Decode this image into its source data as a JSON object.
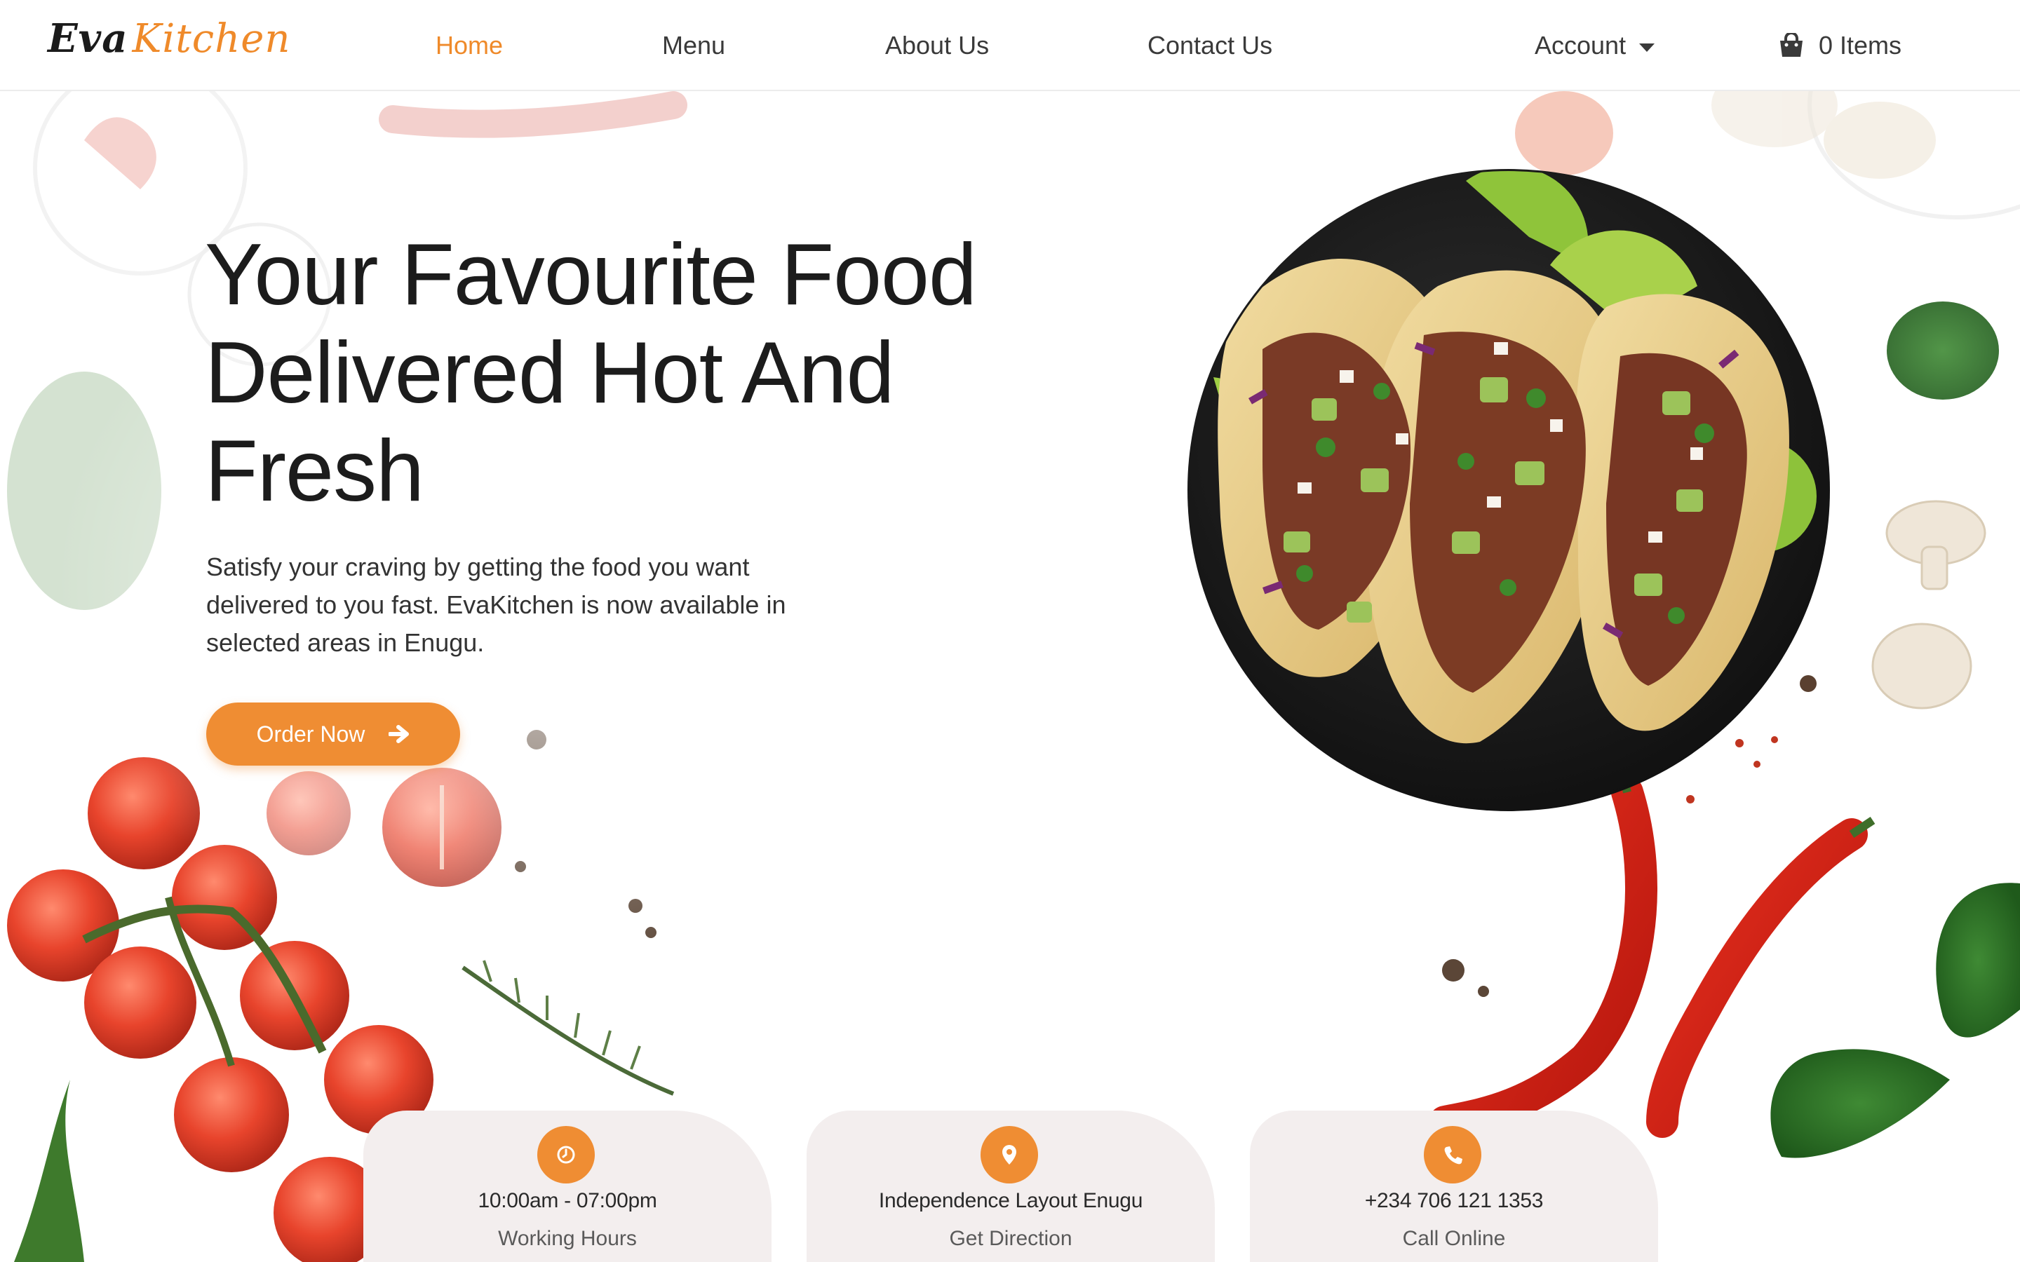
{
  "brand": {
    "part1": "Eva",
    "part2": "Kitchen",
    "accent_color": "#ef8a2a"
  },
  "nav": {
    "home": "Home",
    "menu": "Menu",
    "about": "About Us",
    "contact": "Contact Us",
    "account": "Account",
    "cart": "0 Items",
    "active": "Home",
    "cart_icon": "shopping-bag-icon",
    "account_icon": "caret-down-icon"
  },
  "hero": {
    "title_line1": "Your Favourite Food",
    "title_line2": "Delivered Hot And",
    "title_line3": "Fresh",
    "subtitle": "Satisfy your craving by getting the food you want delivered to you fast. EvaKitchen is now available in selected areas in Enugu.",
    "cta": "Order Now",
    "cta_icon": "arrow-right-icon",
    "button_color": "#ef8d33"
  },
  "info": [
    {
      "icon": "clock-icon",
      "main": "10:00am - 07:00pm",
      "sub": "Working Hours"
    },
    {
      "icon": "map-pin-icon",
      "main": "Independence Layout Enugu",
      "sub": "Get Direction"
    },
    {
      "icon": "phone-icon",
      "main": "+234 706 121 1353",
      "sub": "Call Online"
    }
  ]
}
